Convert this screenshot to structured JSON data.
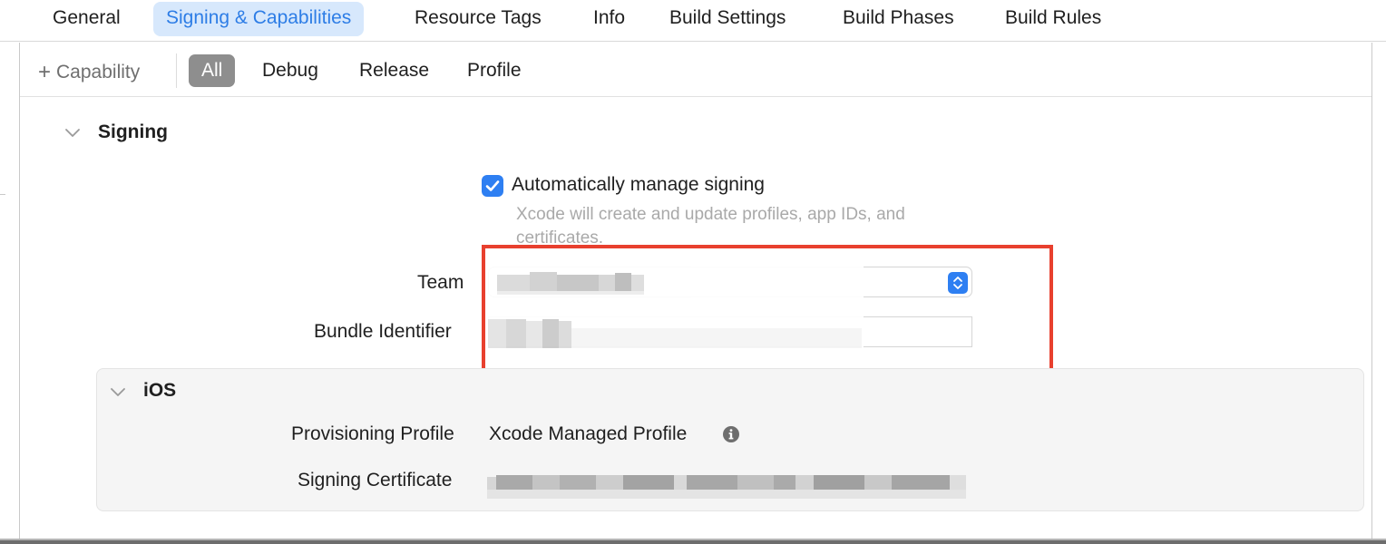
{
  "tabs": [
    {
      "label": "General",
      "active": false
    },
    {
      "label": "Signing & Capabilities",
      "active": true
    },
    {
      "label": "Resource Tags",
      "active": false
    },
    {
      "label": "Info",
      "active": false
    },
    {
      "label": "Build Settings",
      "active": false
    },
    {
      "label": "Build Phases",
      "active": false
    },
    {
      "label": "Build Rules",
      "active": false
    }
  ],
  "filter_bar": {
    "add_capability_label": "Capability",
    "segments": [
      {
        "label": "All",
        "active": true
      },
      {
        "label": "Debug",
        "active": false
      },
      {
        "label": "Release",
        "active": false
      },
      {
        "label": "Profile",
        "active": false
      }
    ]
  },
  "signing": {
    "section_title": "Signing",
    "auto_manage": {
      "checked": true,
      "label": "Automatically manage signing",
      "description": "Xcode will create and update profiles, app IDs, and certificates."
    },
    "team": {
      "label": "Team"
    },
    "bundle_identifier": {
      "label": "Bundle Identifier"
    },
    "highlight_color": "#e8402e"
  },
  "ios": {
    "section_title": "iOS",
    "provisioning_profile": {
      "label": "Provisioning Profile",
      "value": "Xcode Managed Profile"
    },
    "signing_certificate": {
      "label": "Signing Certificate"
    }
  },
  "colors": {
    "accent": "#2e7ff2",
    "active_tab_bg": "#d7e8fc",
    "active_tab_text": "#2d7de6",
    "segment_active_bg": "#8e8e8e"
  },
  "icons": [
    "plus-icon",
    "chevron-down-icon",
    "checkmark-icon",
    "popup-stepper-icon",
    "info-icon"
  ]
}
